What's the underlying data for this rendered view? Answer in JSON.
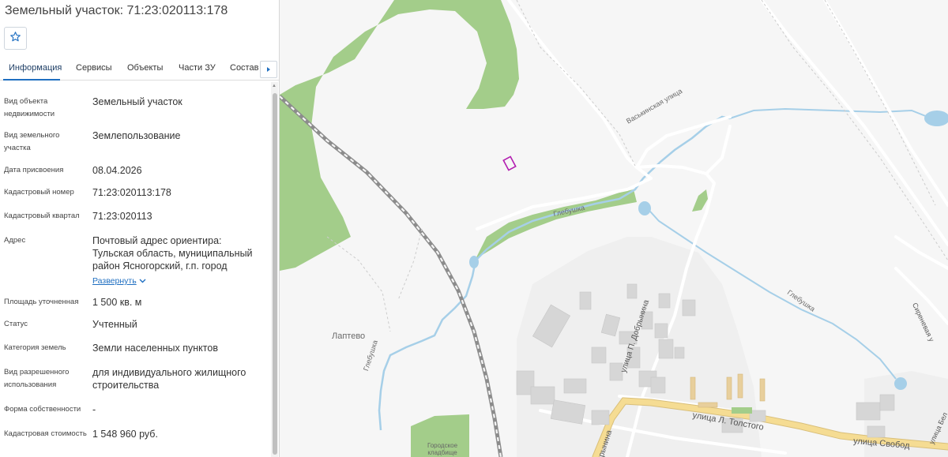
{
  "panel": {
    "title": "Земельный участок: 71:23:020113:178",
    "tabs": [
      {
        "label": "Информация"
      },
      {
        "label": "Сервисы"
      },
      {
        "label": "Объекты"
      },
      {
        "label": "Части ЗУ"
      },
      {
        "label": "Состав"
      }
    ],
    "fields": [
      {
        "label": "Вид объекта недвижимости",
        "value": "Земельный участок"
      },
      {
        "label": "Вид земельного участка",
        "value": "Землепользование"
      },
      {
        "label": "Дата присвоения",
        "value": "08.04.2026"
      },
      {
        "label": "Кадастровый номер",
        "value": "71:23:020113:178"
      },
      {
        "label": "Кадастровый квартал",
        "value": "71:23:020113"
      },
      {
        "label": "Адрес",
        "value": "Почтовый адрес ориентира: Тульская область, муниципальный район Ясногорский, г.п. город",
        "expand_label": "Развернуть"
      },
      {
        "label": "Площадь уточненная",
        "value": "1 500 кв. м"
      },
      {
        "label": "Статус",
        "value": "Учтенный"
      },
      {
        "label": "Категория земель",
        "value": "Земли населенных пунктов"
      },
      {
        "label": "Вид разрешенного использования",
        "value": "для индивидуального жилищного строительства"
      },
      {
        "label": "Форма собственности",
        "value": "-"
      },
      {
        "label": "Кадастровая стоимость",
        "value": "1 548 960 руб."
      }
    ]
  },
  "map": {
    "labels": {
      "laptevo": "Лаптево",
      "vaskinskaya": "Васькинская улица",
      "glebushka_top": "Глебушка",
      "glebushka_mid": "Глебушка",
      "glebushka_left": "Глебушка",
      "dobrynina": "улица П. Добрынина",
      "dobrynina_lower": "рынина",
      "tolstogo": "улица Л. Толстого",
      "svobody": "улица Свобод",
      "sirenevaya": "Сиреневая у",
      "bel": "улица Бел",
      "cemetery": "Городское кладбище"
    },
    "colors": {
      "forest": "#a3cd8a",
      "water": "#a6cfe8",
      "road_major": "#f5dc93",
      "parcel": "#b21db0",
      "building": "#d6d6d6"
    }
  }
}
